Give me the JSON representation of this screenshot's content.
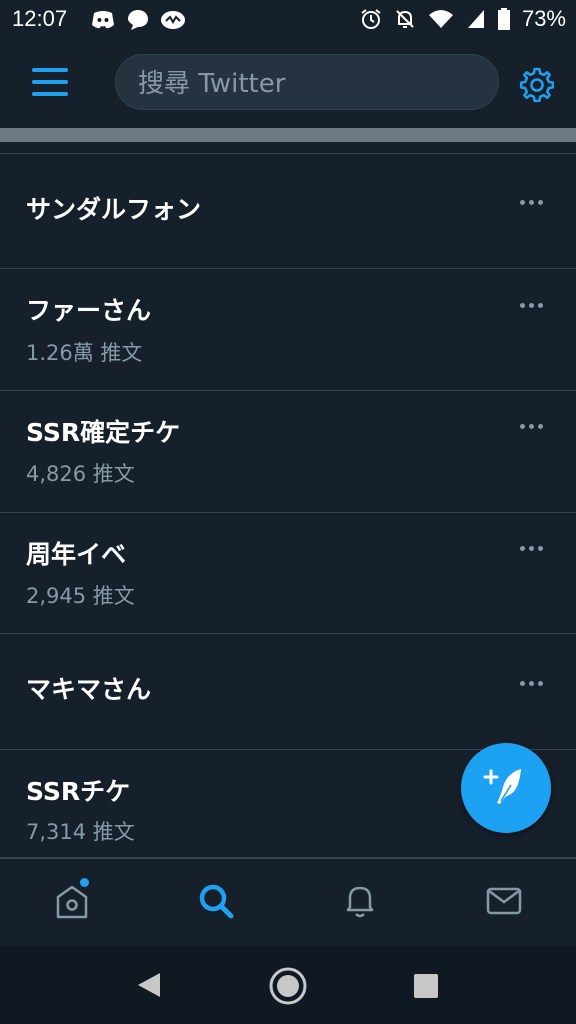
{
  "status_bar": {
    "time": "12:07",
    "battery": "73%",
    "left_icons": [
      "discord-icon",
      "chat-bubble-icon",
      "stream-icon"
    ],
    "right_icons": [
      "alarm-icon",
      "bell-muted-icon",
      "wifi-icon",
      "signal-icon",
      "battery-icon"
    ]
  },
  "header": {
    "search_placeholder": "搜尋 Twitter",
    "menu_icon": "hamburger-icon",
    "settings_icon": "gear-icon",
    "accent_color": "#1da1f2"
  },
  "trends": [
    {
      "name": "サンダルフォン",
      "count": ""
    },
    {
      "name": "ファーさん",
      "count": "1.26萬 推文"
    },
    {
      "name": "SSR確定チケ",
      "count": "4,826 推文"
    },
    {
      "name": "周年イベ",
      "count": "2,945 推文"
    },
    {
      "name": "マキマさん",
      "count": ""
    },
    {
      "name": "SSRチケ",
      "count": "7,314 推文"
    }
  ],
  "fab": {
    "icon": "compose-tweet-icon"
  },
  "bottom_nav": {
    "items": [
      "home-icon",
      "search-icon",
      "notifications-icon",
      "messages-icon"
    ],
    "active": "search-icon"
  },
  "system_nav": [
    "back-icon",
    "home-circle-icon",
    "recents-icon"
  ]
}
